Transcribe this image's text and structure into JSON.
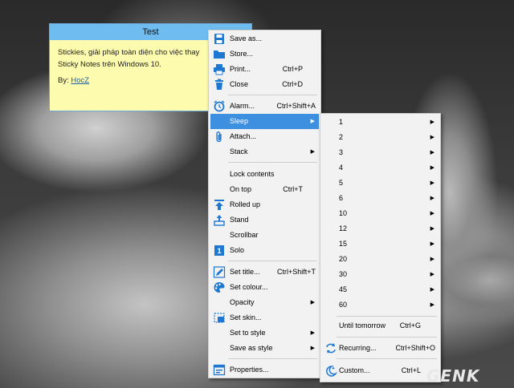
{
  "note": {
    "title": "Test",
    "line1": "Stickies, giải pháp toàn diện cho việc thay",
    "line2": "Sticky Notes trên Windows 10.",
    "by_label": "By: ",
    "author_link": "HocZ"
  },
  "main_menu": {
    "save_as": "Save as...",
    "store": "Store...",
    "print": "Print...",
    "print_shortcut": "Ctrl+P",
    "close": "Close",
    "close_shortcut": "Ctrl+D",
    "alarm": "Alarm...",
    "alarm_shortcut": "Ctrl+Shift+A",
    "sleep": "Sleep",
    "attach": "Attach...",
    "stack": "Stack",
    "lock_contents": "Lock contents",
    "on_top": "On top",
    "on_top_shortcut": "Ctrl+T",
    "rolled_up": "Rolled up",
    "stand": "Stand",
    "scrollbar": "Scrollbar",
    "solo": "Solo",
    "set_title": "Set title...",
    "set_title_shortcut": "Ctrl+Shift+T",
    "set_colour": "Set colour...",
    "opacity": "Opacity",
    "set_skin": "Set skin...",
    "set_to_style": "Set to style",
    "save_as_style": "Save as style",
    "properties": "Properties..."
  },
  "sleep_menu": {
    "durations": [
      "1",
      "2",
      "3",
      "4",
      "5",
      "6",
      "10",
      "12",
      "15",
      "20",
      "30",
      "45",
      "60"
    ],
    "until_tomorrow": "Until tomorrow",
    "until_tomorrow_shortcut": "Ctrl+G",
    "recurring": "Recurring...",
    "recurring_shortcut": "Ctrl+Shift+O",
    "custom": "Custom...",
    "custom_shortcut": "Ctrl+L"
  },
  "watermark": "GENK",
  "colors": {
    "note_background": "#fdfbad",
    "note_title_bar": "#6ebcf0",
    "menu_background": "#f2f2f2",
    "highlight": "#3d8fe0",
    "icon_blue": "#1e78d2"
  }
}
